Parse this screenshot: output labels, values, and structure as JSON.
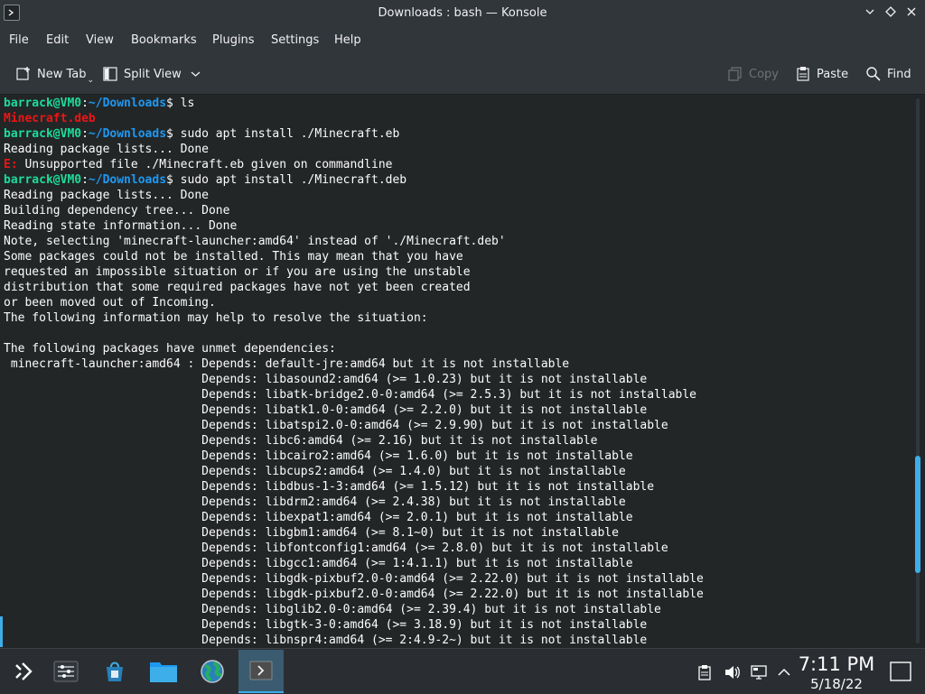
{
  "window": {
    "title": "Downloads : bash — Konsole"
  },
  "menu": [
    "File",
    "Edit",
    "View",
    "Bookmarks",
    "Plugins",
    "Settings",
    "Help"
  ],
  "toolbar": {
    "new_tab": "New Tab",
    "split_view": "Split View",
    "copy": "Copy",
    "paste": "Paste",
    "find": "Find"
  },
  "terminal": {
    "user_host": "barrack@VM0",
    "path": "~/Downloads",
    "lines": [
      {
        "kind": "prompt",
        "cmd": "ls"
      },
      {
        "kind": "red",
        "text": "Minecraft.deb"
      },
      {
        "kind": "prompt",
        "cmd": "sudo apt install ./Minecraft.eb"
      },
      {
        "kind": "out",
        "text": "Reading package lists... Done"
      },
      {
        "kind": "err",
        "tag": "E:",
        "text": " Unsupported file ./Minecraft.eb given on commandline"
      },
      {
        "kind": "prompt",
        "cmd": "sudo apt install ./Minecraft.deb"
      },
      {
        "kind": "out",
        "text": "Reading package lists... Done"
      },
      {
        "kind": "out",
        "text": "Building dependency tree... Done"
      },
      {
        "kind": "out",
        "text": "Reading state information... Done"
      },
      {
        "kind": "out",
        "text": "Note, selecting 'minecraft-launcher:amd64' instead of './Minecraft.deb'"
      },
      {
        "kind": "out",
        "text": "Some packages could not be installed. This may mean that you have"
      },
      {
        "kind": "out",
        "text": "requested an impossible situation or if you are using the unstable"
      },
      {
        "kind": "out",
        "text": "distribution that some required packages have not yet been created"
      },
      {
        "kind": "out",
        "text": "or been moved out of Incoming."
      },
      {
        "kind": "out",
        "text": "The following information may help to resolve the situation:"
      },
      {
        "kind": "out",
        "text": ""
      },
      {
        "kind": "out",
        "text": "The following packages have unmet dependencies:"
      },
      {
        "kind": "out",
        "text": " minecraft-launcher:amd64 : Depends: default-jre:amd64 but it is not installable"
      },
      {
        "kind": "out",
        "text": "                            Depends: libasound2:amd64 (>= 1.0.23) but it is not installable"
      },
      {
        "kind": "out",
        "text": "                            Depends: libatk-bridge2.0-0:amd64 (>= 2.5.3) but it is not installable"
      },
      {
        "kind": "out",
        "text": "                            Depends: libatk1.0-0:amd64 (>= 2.2.0) but it is not installable"
      },
      {
        "kind": "out",
        "text": "                            Depends: libatspi2.0-0:amd64 (>= 2.9.90) but it is not installable"
      },
      {
        "kind": "out",
        "text": "                            Depends: libc6:amd64 (>= 2.16) but it is not installable"
      },
      {
        "kind": "out",
        "text": "                            Depends: libcairo2:amd64 (>= 1.6.0) but it is not installable"
      },
      {
        "kind": "out",
        "text": "                            Depends: libcups2:amd64 (>= 1.4.0) but it is not installable"
      },
      {
        "kind": "out",
        "text": "                            Depends: libdbus-1-3:amd64 (>= 1.5.12) but it is not installable"
      },
      {
        "kind": "out",
        "text": "                            Depends: libdrm2:amd64 (>= 2.4.38) but it is not installable"
      },
      {
        "kind": "out",
        "text": "                            Depends: libexpat1:amd64 (>= 2.0.1) but it is not installable"
      },
      {
        "kind": "out",
        "text": "                            Depends: libgbm1:amd64 (>= 8.1~0) but it is not installable"
      },
      {
        "kind": "out",
        "text": "                            Depends: libfontconfig1:amd64 (>= 2.8.0) but it is not installable"
      },
      {
        "kind": "out",
        "text": "                            Depends: libgcc1:amd64 (>= 1:4.1.1) but it is not installable"
      },
      {
        "kind": "out",
        "text": "                            Depends: libgdk-pixbuf2.0-0:amd64 (>= 2.22.0) but it is not installable"
      },
      {
        "kind": "out",
        "text": "                            Depends: libgdk-pixbuf2.0-0:amd64 (>= 2.22.0) but it is not installable"
      },
      {
        "kind": "out",
        "text": "                            Depends: libglib2.0-0:amd64 (>= 2.39.4) but it is not installable"
      },
      {
        "kind": "out",
        "text": "                            Depends: libgtk-3-0:amd64 (>= 3.18.9) but it is not installable"
      },
      {
        "kind": "out",
        "text": "                            Depends: libnspr4:amd64 (>= 2:4.9-2~) but it is not installable"
      }
    ]
  },
  "taskbar": {
    "apps": [
      "application-launcher-icon",
      "task-manager-icon",
      "discover-store-icon",
      "file-manager-icon",
      "browser-globe-icon",
      "konsole-icon"
    ],
    "tray": [
      "clipboard-icon",
      "volume-icon",
      "network-icon",
      "expand-tray-icon"
    ],
    "time": "7:11 PM",
    "date": "5/18/22"
  }
}
